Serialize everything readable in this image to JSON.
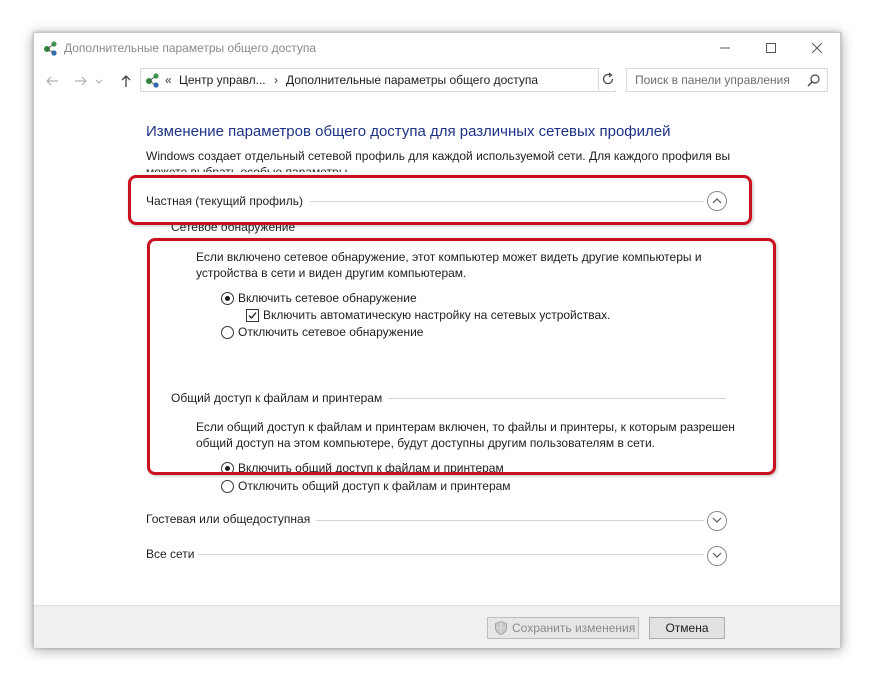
{
  "window": {
    "title": "Дополнительные параметры общего доступа"
  },
  "navbar": {
    "breadcrumb_prefix": "«",
    "breadcrumb_parent": "Центр управл...",
    "breadcrumb_sep": "›",
    "breadcrumb_current": "Дополнительные параметры общего доступа",
    "search_placeholder": "Поиск в панели управления"
  },
  "main": {
    "title": "Изменение параметров общего доступа для различных сетевых профилей",
    "intro": "Windows создает отдельный сетевой профиль для каждой используемой сети. Для каждого профиля вы можете выбрать особые параметры.",
    "profiles": [
      {
        "label": "Частная (текущий профиль)",
        "expanded": true
      },
      {
        "label": "Гостевая или общедоступная",
        "expanded": false
      },
      {
        "label": "Все сети",
        "expanded": false
      }
    ],
    "discovery": {
      "heading": "Сетевое обнаружение",
      "description": "Если включено сетевое обнаружение, этот компьютер может видеть другие компьютеры и устройства в сети и виден другим компьютерам.",
      "option_on": "Включить сетевое обнаружение",
      "auto_setup": "Включить автоматическую настройку на сетевых устройствах.",
      "option_off": "Отключить сетевое обнаружение"
    },
    "sharing": {
      "heading": "Общий доступ к файлам и принтерам",
      "description": "Если общий доступ к файлам и принтерам включен, то файлы и принтеры, к которым разрешен общий доступ на этом компьютере, будут доступны другим пользователям в сети.",
      "option_on": "Включить общий доступ к файлам и принтерам",
      "option_off": "Отключить общий доступ к файлам и принтерам"
    }
  },
  "footer": {
    "save_label": "Сохранить изменения",
    "cancel_label": "Отмена"
  },
  "colors": {
    "title_blue": "#1e3287",
    "highlight_red": "#c8101e"
  },
  "icons": [
    "network-icon",
    "back-arrow-icon",
    "forward-arrow-icon",
    "up-arrow-icon",
    "refresh-icon",
    "search-icon",
    "shield-icon",
    "chevron-up-icon",
    "chevron-down-icon"
  ]
}
